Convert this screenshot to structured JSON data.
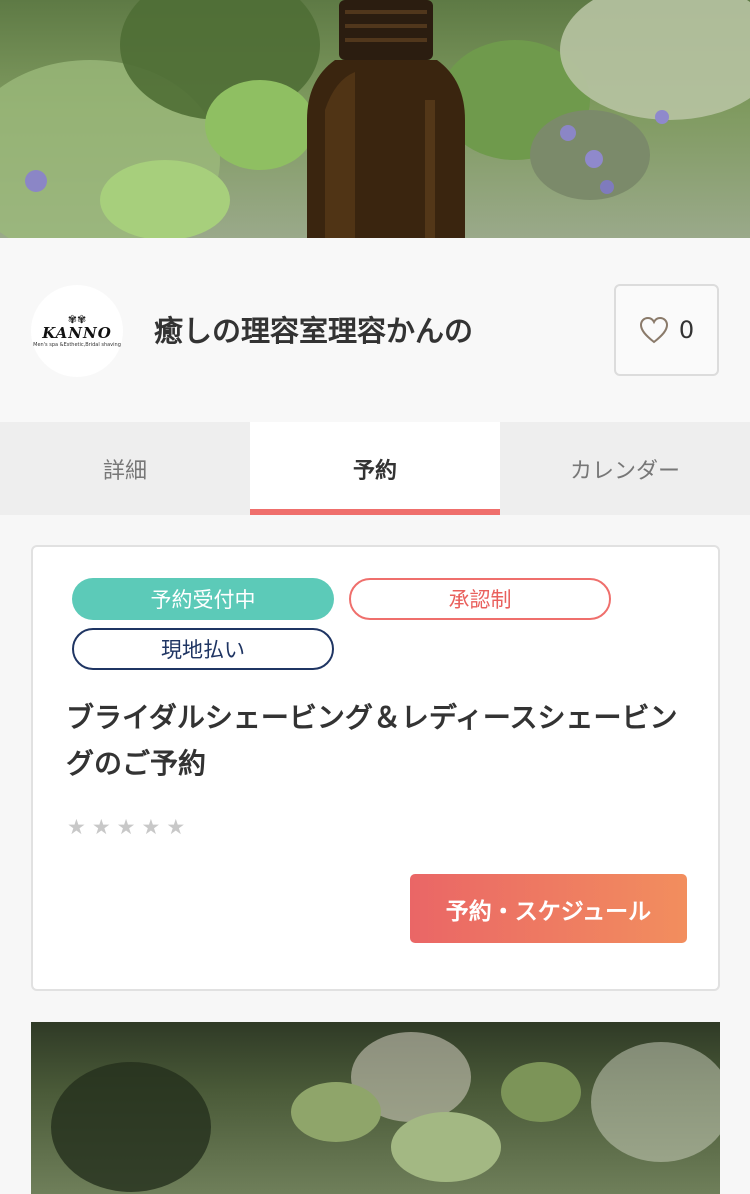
{
  "hero": {
    "image": "essential-oil-bottle-with-herbs-photo"
  },
  "shop": {
    "logo_word": "KANNO",
    "logo_crest": "✾✾",
    "logo_tagline": "Men's spa &Esthetic,Bridal shaving",
    "name": "癒しの理容室理容かんの",
    "like_count": "0",
    "like_icon": "heart-outline-icon"
  },
  "tabs": [
    {
      "label": "詳細",
      "active": false
    },
    {
      "label": "予約",
      "active": true
    },
    {
      "label": "カレンダー",
      "active": false
    }
  ],
  "plan": {
    "badges": [
      "予約受付中",
      "承認制",
      "現地払い"
    ],
    "title": "ブライダルシェービング＆レディースシェービングのご予約",
    "rating_stars": 5,
    "rating_filled": 0,
    "button_label": "予約・スケジュール"
  },
  "colors": {
    "accent_red": "#ef6f6c",
    "badge_green": "#5ccab8",
    "badge_navy": "#1f3563",
    "button_gradient_start": "#ea6666",
    "button_gradient_end": "#f28e5e"
  },
  "second_photo": {
    "image": "green-herb-leaves-photo"
  }
}
